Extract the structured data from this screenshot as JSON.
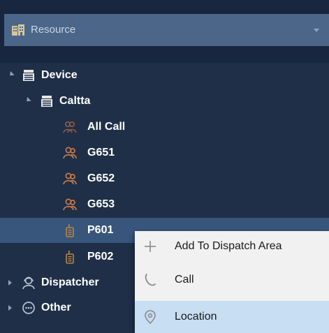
{
  "resource_bar": {
    "label": "Resource",
    "icon": "building-icon"
  },
  "tree": {
    "device": {
      "label": "Device"
    },
    "caltta": {
      "label": "Caltta"
    },
    "all_call": {
      "label": "All Call"
    },
    "g651": {
      "label": "G651"
    },
    "g652": {
      "label": "G652"
    },
    "g653": {
      "label": "G653"
    },
    "p601": {
      "label": "P601",
      "selected": true
    },
    "p602": {
      "label": "P602"
    },
    "dispatcher": {
      "label": "Dispatcher"
    },
    "other": {
      "label": "Other"
    }
  },
  "context_menu": {
    "items": [
      {
        "label": "Add To Dispatch Area",
        "icon": "plus-icon"
      },
      {
        "label": "Call",
        "icon": "phone-icon"
      },
      {
        "label": "Location",
        "icon": "location-pin-icon",
        "highlighted": true
      }
    ]
  },
  "colors": {
    "panel_bg": "#1f2f47",
    "header_bg": "#182640",
    "resource_bar_bg": "#4b6688",
    "selected_row_bg": "#38557b",
    "menu_bg": "#f1f1f1",
    "menu_hover_bg": "#c7def3",
    "group_icon": "#c97a4a"
  }
}
